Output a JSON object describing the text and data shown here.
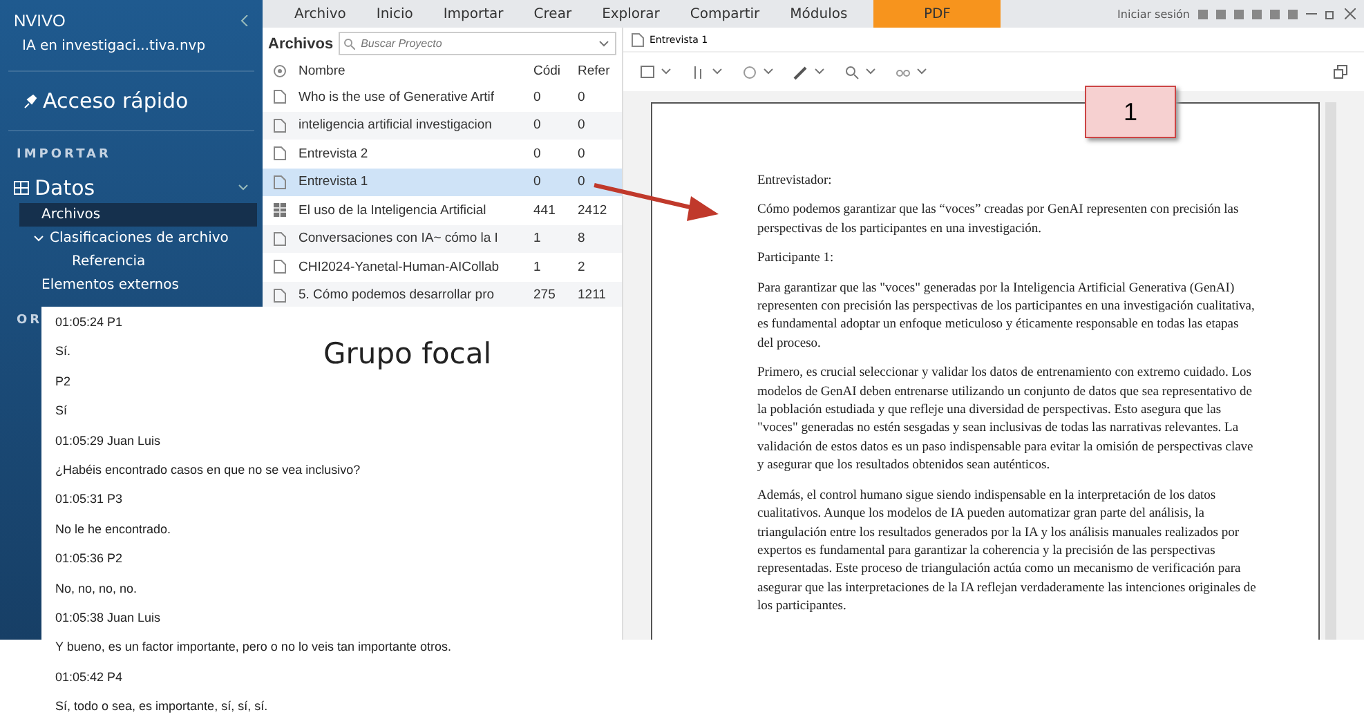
{
  "sidebar": {
    "app_name": "NVIVO",
    "project": "IA en investigaci...tiva.nvp",
    "quick_access": "Acceso rápido",
    "section": "IMPORTAR",
    "group": {
      "label": "Datos",
      "expanded": true
    },
    "items": [
      {
        "label": "Archivos",
        "selected": true
      },
      {
        "label": "Clasificaciones de archivo",
        "selected": false,
        "expanded": true,
        "children": [
          {
            "label": "Referencia",
            "selected": false
          }
        ]
      },
      {
        "label": "Elementos externos",
        "selected": false
      }
    ],
    "next_section": "OR"
  },
  "ribbon": {
    "tabs": [
      {
        "label": "Archivo",
        "kind": "tab"
      },
      {
        "label": "Inicio",
        "kind": "tab"
      },
      {
        "label": "Importar",
        "kind": "tab"
      },
      {
        "label": "Crear",
        "kind": "tab"
      },
      {
        "label": "Explorar",
        "kind": "tab"
      },
      {
        "label": "Compartir",
        "kind": "tab"
      },
      {
        "label": "Módulos",
        "kind": "tab"
      },
      {
        "label": "PDF",
        "kind": "contextual"
      }
    ],
    "sign_in": "Iniciar sesión"
  },
  "file_list": {
    "title": "Archivos",
    "search": {
      "placeholder": "Buscar Proyecto"
    },
    "columns": [
      "Nombre",
      "Códi",
      "Refer"
    ],
    "rows": [
      {
        "name": "Who is the use of Generative Artif",
        "codes": "0",
        "refs": "0",
        "kind": "document",
        "selected": false
      },
      {
        "name": "inteligencia artificial investigacion",
        "codes": "0",
        "refs": "0",
        "kind": "document",
        "selected": false
      },
      {
        "name": "Entrevista 2",
        "codes": "0",
        "refs": "0",
        "kind": "document",
        "selected": false
      },
      {
        "name": "Entrevista 1",
        "codes": "0",
        "refs": "0",
        "kind": "document",
        "selected": true
      },
      {
        "name": "El uso de la Inteligencia Artificial",
        "codes": "441",
        "refs": "2412",
        "kind": "dataset",
        "selected": false
      },
      {
        "name": "Conversaciones con IA~ cómo la I",
        "codes": "1",
        "refs": "8",
        "kind": "document",
        "selected": false
      },
      {
        "name": "CHI2024-Yanetal-Human-AICollab",
        "codes": "1",
        "refs": "2",
        "kind": "document",
        "selected": false
      },
      {
        "name": "5. Cómo podemos desarrollar pro",
        "codes": "275",
        "refs": "1211",
        "kind": "document",
        "selected": false
      }
    ]
  },
  "document": {
    "tab": "Entrevista 1",
    "paragraphs": [
      "Entrevistador:",
      "Cómo podemos garantizar que las “voces” creadas por GenAI representen con precisión las perspectivas de los participantes en una investigación.",
      "Participante 1:",
      "Para garantizar que las \"voces\" generadas por la Inteligencia Artificial Generativa (GenAI) representen con precisión las perspectivas de los participantes en una investigación cualitativa, es fundamental adoptar un enfoque meticuloso y éticamente responsable en todas las etapas del proceso.",
      "Primero, es crucial seleccionar y validar los datos de entrenamiento con extremo cuidado. Los modelos de GenAI deben entrenarse utilizando un conjunto de datos que sea representativo de la población estudiada y que refleje una diversidad de perspectivas. Esto asegura que las \"voces\" generadas no estén sesgadas y sean inclusivas de todas las narrativas relevantes. La validación de estos datos es un paso indispensable para evitar la omisión de perspectivas clave y asegurar que los resultados obtenidos sean auténticos.",
      "Además, el control humano sigue siendo indispensable en la interpretación de los datos cualitativos. Aunque los modelos de IA pueden automatizar gran parte del análisis, la triangulación entre los resultados generados por la IA y los análisis manuales realizados por expertos es fundamental para garantizar la coherencia y la precisión de las perspectivas representadas. Este proceso de triangulación actúa como un mecanismo de verificación para asegurar que las interpretaciones de la IA reflejan verdaderamente las intenciones originales de los participantes."
    ]
  },
  "annotation": {
    "badge": "1"
  },
  "transcript": {
    "title": "Grupo focal",
    "lines": [
      "01:05:24 P1",
      "Sí.",
      "P2",
      "Sí",
      "01:05:29 Juan Luis",
      "¿Habéis encontrado casos en que no se vea inclusivo?",
      "01:05:31 P3",
      "No le he encontrado.",
      "01:05:36 P2",
      "No, no, no, no.",
      "01:05:38 Juan Luis",
      "Y bueno, es un factor importante, pero o no lo veis tan importante otros.",
      "01:05:42 P4",
      "Sí, todo o sea, es importante, sí, sí, sí."
    ]
  }
}
